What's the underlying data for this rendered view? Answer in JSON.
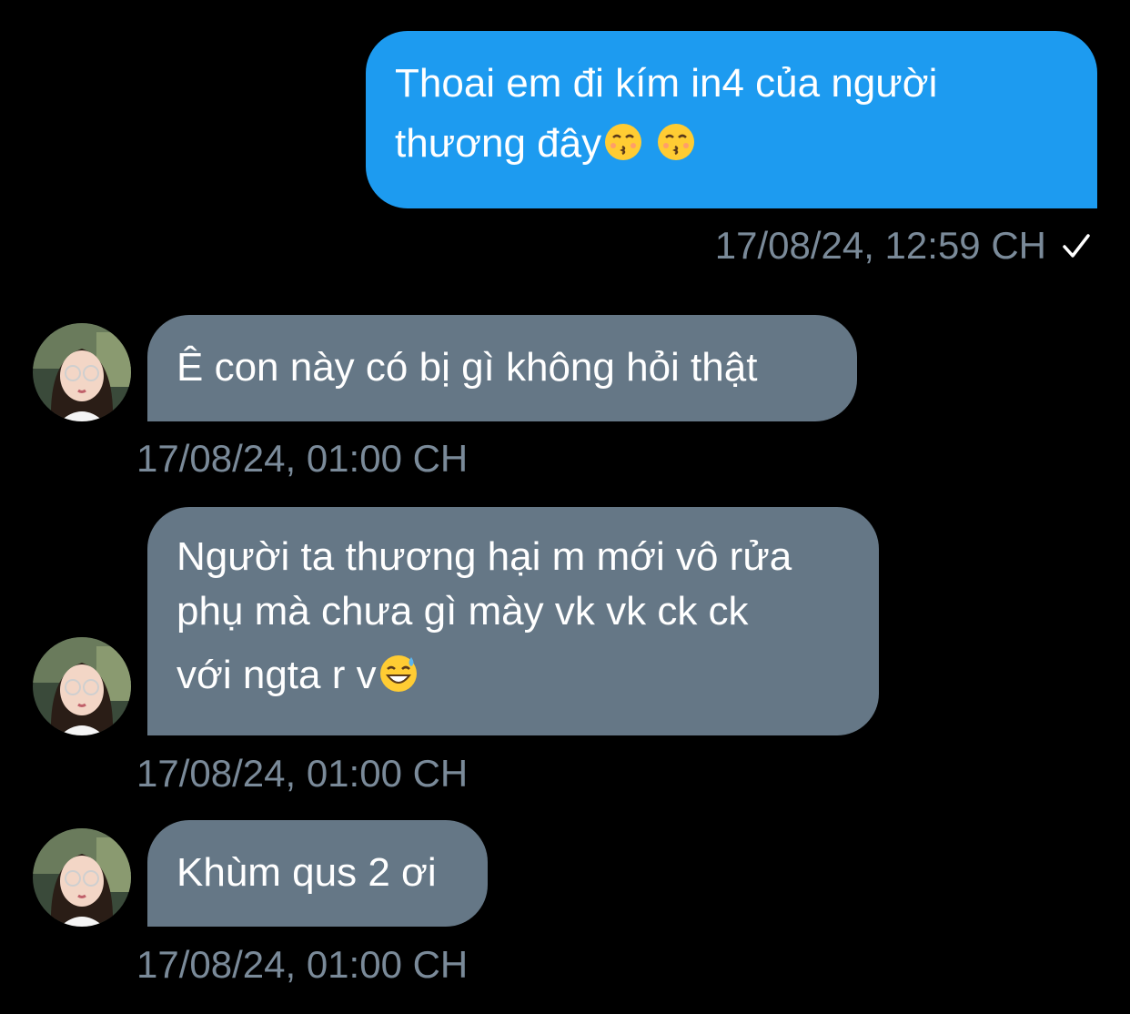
{
  "conversation": {
    "messages": [
      {
        "direction": "outgoing",
        "lines": [
          "Thoai em đi kím in4 của người",
          "thương đây"
        ],
        "emoji": [
          "kissing-face-emoji",
          "kissing-face-emoji"
        ],
        "timestamp": "17/08/24, 12:59 CH",
        "status_icon": "checkmark-icon"
      },
      {
        "direction": "incoming",
        "lines": [
          "Ê con này có bị gì không hỏi thật"
        ],
        "timestamp": "17/08/24, 01:00 CH"
      },
      {
        "direction": "incoming",
        "lines": [
          "Người ta thương hại m mới vô rửa",
          "phụ mà chưa gì mày vk vk ck ck",
          "với ngta r v"
        ],
        "emoji": [
          "grinning-sweat-emoji"
        ],
        "timestamp": "17/08/24, 01:00 CH"
      },
      {
        "direction": "incoming",
        "lines": [
          "Khùm qus 2 ơi"
        ],
        "timestamp": "17/08/24, 01:00 CH"
      }
    ]
  },
  "colors": {
    "background": "#000000",
    "outgoing_bubble": "#1d9bf0",
    "incoming_bubble": "#657786",
    "timestamp_text": "#7a8a99"
  }
}
